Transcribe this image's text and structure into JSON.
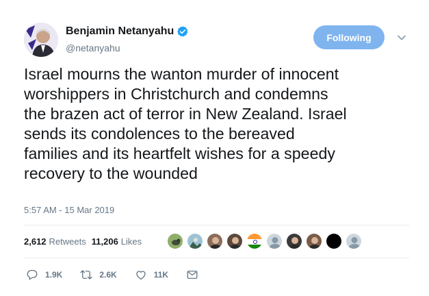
{
  "author": {
    "name": "Benjamin Netanyahu",
    "handle": "@netanyahu",
    "verified": true
  },
  "follow_button": {
    "label": "Following"
  },
  "tweet": {
    "lines": [
      "Israel mourns the wanton murder of innocent",
      "worshippers in Christchurch and condemns",
      "the brazen act of terror in New Zealand. Israel",
      "sends its condolences to the bereaved",
      "families and its heartfelt wishes for a speedy",
      "recovery to the wounded"
    ],
    "timestamp": "5:57 AM - 15 Mar 2019"
  },
  "stats": {
    "retweets_count": "2,612",
    "retweets_label": "Retweets",
    "likes_count": "11,206",
    "likes_label": "Likes"
  },
  "likers": [
    {
      "icon": "bird-photo-avatar",
      "color": "#6b8f4a"
    },
    {
      "icon": "landscape-avatar",
      "color": "#4f7a8a"
    },
    {
      "icon": "person-photo-avatar",
      "color": "#8a6e5a"
    },
    {
      "icon": "person-photo-avatar",
      "color": "#5d4a3c"
    },
    {
      "icon": "india-flag-avatar",
      "color": "#ff9933"
    },
    {
      "icon": "default-avatar",
      "color": "#aab8c2"
    },
    {
      "icon": "person-photo-avatar",
      "color": "#3a3a3a"
    },
    {
      "icon": "person-photo-avatar",
      "color": "#7a5c48"
    },
    {
      "icon": "black-avatar",
      "color": "#000000"
    },
    {
      "icon": "default-avatar",
      "color": "#aab8c2"
    }
  ],
  "actions": {
    "replies": "1.9K",
    "retweets": "2.6K",
    "likes": "11K"
  },
  "colors": {
    "accent": "#1da1f2",
    "follow_button": "#7fb4ef",
    "muted_text": "#657786"
  }
}
